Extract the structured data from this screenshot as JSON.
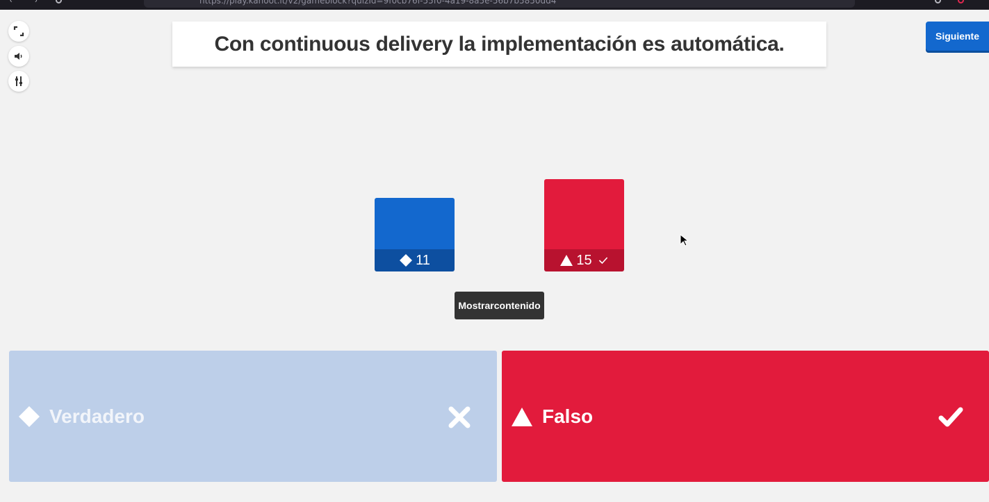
{
  "browser": {
    "url": "https://play.kahoot.it/v2/gameblock?quizId=9f0cb76f-55f0-4a19-8a5e-56b7b5850dd4"
  },
  "tools": {
    "fullscreen_icon": "fullscreen-icon",
    "sound_icon": "speaker-icon",
    "settings_icon": "sliders-icon"
  },
  "question": {
    "text": "Con continuous delivery la implementación es automática."
  },
  "next_button": {
    "label": "Siguiente"
  },
  "results": {
    "answers": [
      {
        "shape": "diamond",
        "count": 11,
        "color": "#1368ce",
        "correct": false
      },
      {
        "shape": "triangle",
        "count": 15,
        "color": "#e21b3c",
        "correct": true
      }
    ]
  },
  "show_content_button": {
    "label_line1": "Mostrar",
    "label_line2": "contenido"
  },
  "options": [
    {
      "label": "Verdadero",
      "shape": "diamond",
      "result_icon": "cross-icon",
      "color": "#bdcfe9"
    },
    {
      "label": "Falso",
      "shape": "triangle",
      "result_icon": "check-icon",
      "color": "#e21b3c"
    }
  ]
}
